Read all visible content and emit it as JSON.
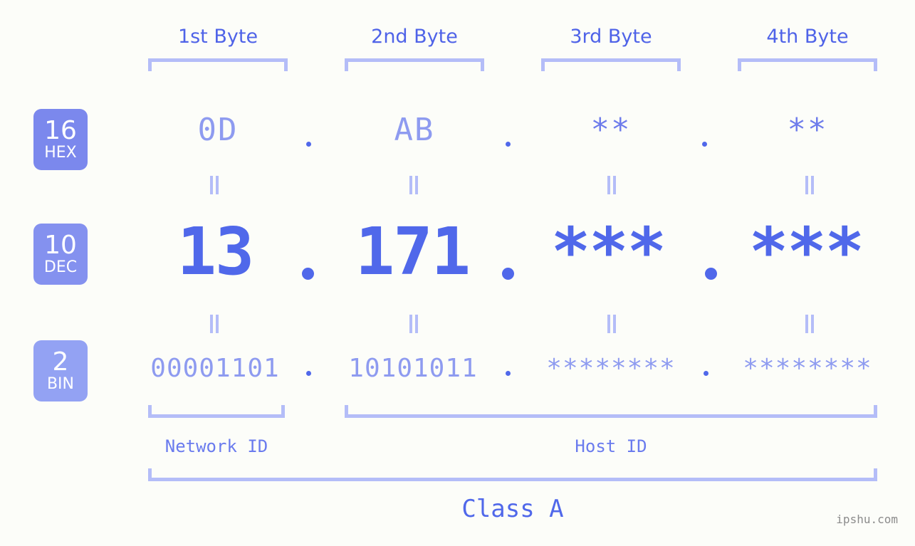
{
  "meta": {
    "watermark": "ipshu.com",
    "background": "#fcfdf9",
    "accent": "#5068ea",
    "accent_light": "#b4bdf8",
    "accent_mid": "#8e9bf0"
  },
  "byte_headers": [
    {
      "label": "1st Byte"
    },
    {
      "label": "2nd Byte"
    },
    {
      "label": "3rd Byte"
    },
    {
      "label": "4th Byte"
    }
  ],
  "radix_badges": [
    {
      "number": "16",
      "label": "HEX",
      "color": "#7b88ed"
    },
    {
      "number": "10",
      "label": "DEC",
      "color": "#8491ef"
    },
    {
      "number": "2",
      "label": "BIN",
      "color": "#93a2f3"
    }
  ],
  "rows": {
    "hex": {
      "values": [
        "0D",
        "AB",
        "**",
        "**"
      ],
      "separator": "."
    },
    "dec": {
      "values": [
        "13",
        "171",
        "***",
        "***"
      ],
      "separator": "."
    },
    "bin": {
      "values": [
        "00001101",
        "10101011",
        "********",
        "********"
      ],
      "separator": "."
    }
  },
  "equals_symbol": "=",
  "sections": [
    {
      "label": "Network ID"
    },
    {
      "label": "Host ID"
    }
  ],
  "class": {
    "label": "Class A"
  }
}
